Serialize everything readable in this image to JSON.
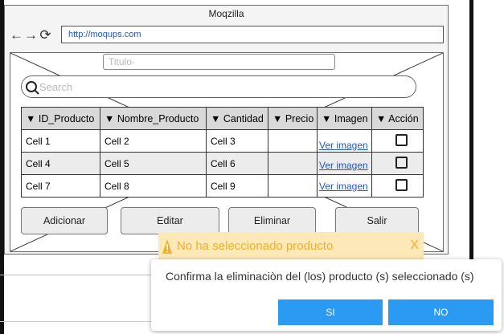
{
  "browser": {
    "title": "Moqzilla",
    "url": "http://moqups.com"
  },
  "form": {
    "title_placeholder": "Titulo-",
    "search_placeholder": "Search"
  },
  "table": {
    "headers": [
      "▼ ID_Producto",
      "▼ Nombre_Producto",
      "▼ Cantidad",
      "▼ Precio",
      "▼ Imagen",
      "▼ Acción"
    ],
    "rows": [
      {
        "id": "Cell 1",
        "nombre": "Cell 2",
        "cantidad": "Cell 3",
        "precio": "",
        "imagen": "Ver imagen",
        "checked": false
      },
      {
        "id": "Cell 4",
        "nombre": "Cell 5",
        "cantidad": "Cell 6",
        "precio": "",
        "imagen": "Ver imagen",
        "checked": false
      },
      {
        "id": "Cell 7",
        "nombre": "Cell 8",
        "cantidad": "Cell 9",
        "precio": "",
        "imagen": "Ver imagen",
        "checked": false
      }
    ]
  },
  "buttons": {
    "add": "Adicionar",
    "edit": "Editar",
    "delete": "Eliminar",
    "exit": "Salir"
  },
  "warning": {
    "message": "No ha seleccionado producto",
    "close": "X",
    "color": "#f3b027"
  },
  "dialog": {
    "message": "Confirma la eliminaciòn del (los) producto (s) seleccionado (s)",
    "yes": "SI",
    "no": "NO",
    "button_color": "#2b9af3"
  }
}
